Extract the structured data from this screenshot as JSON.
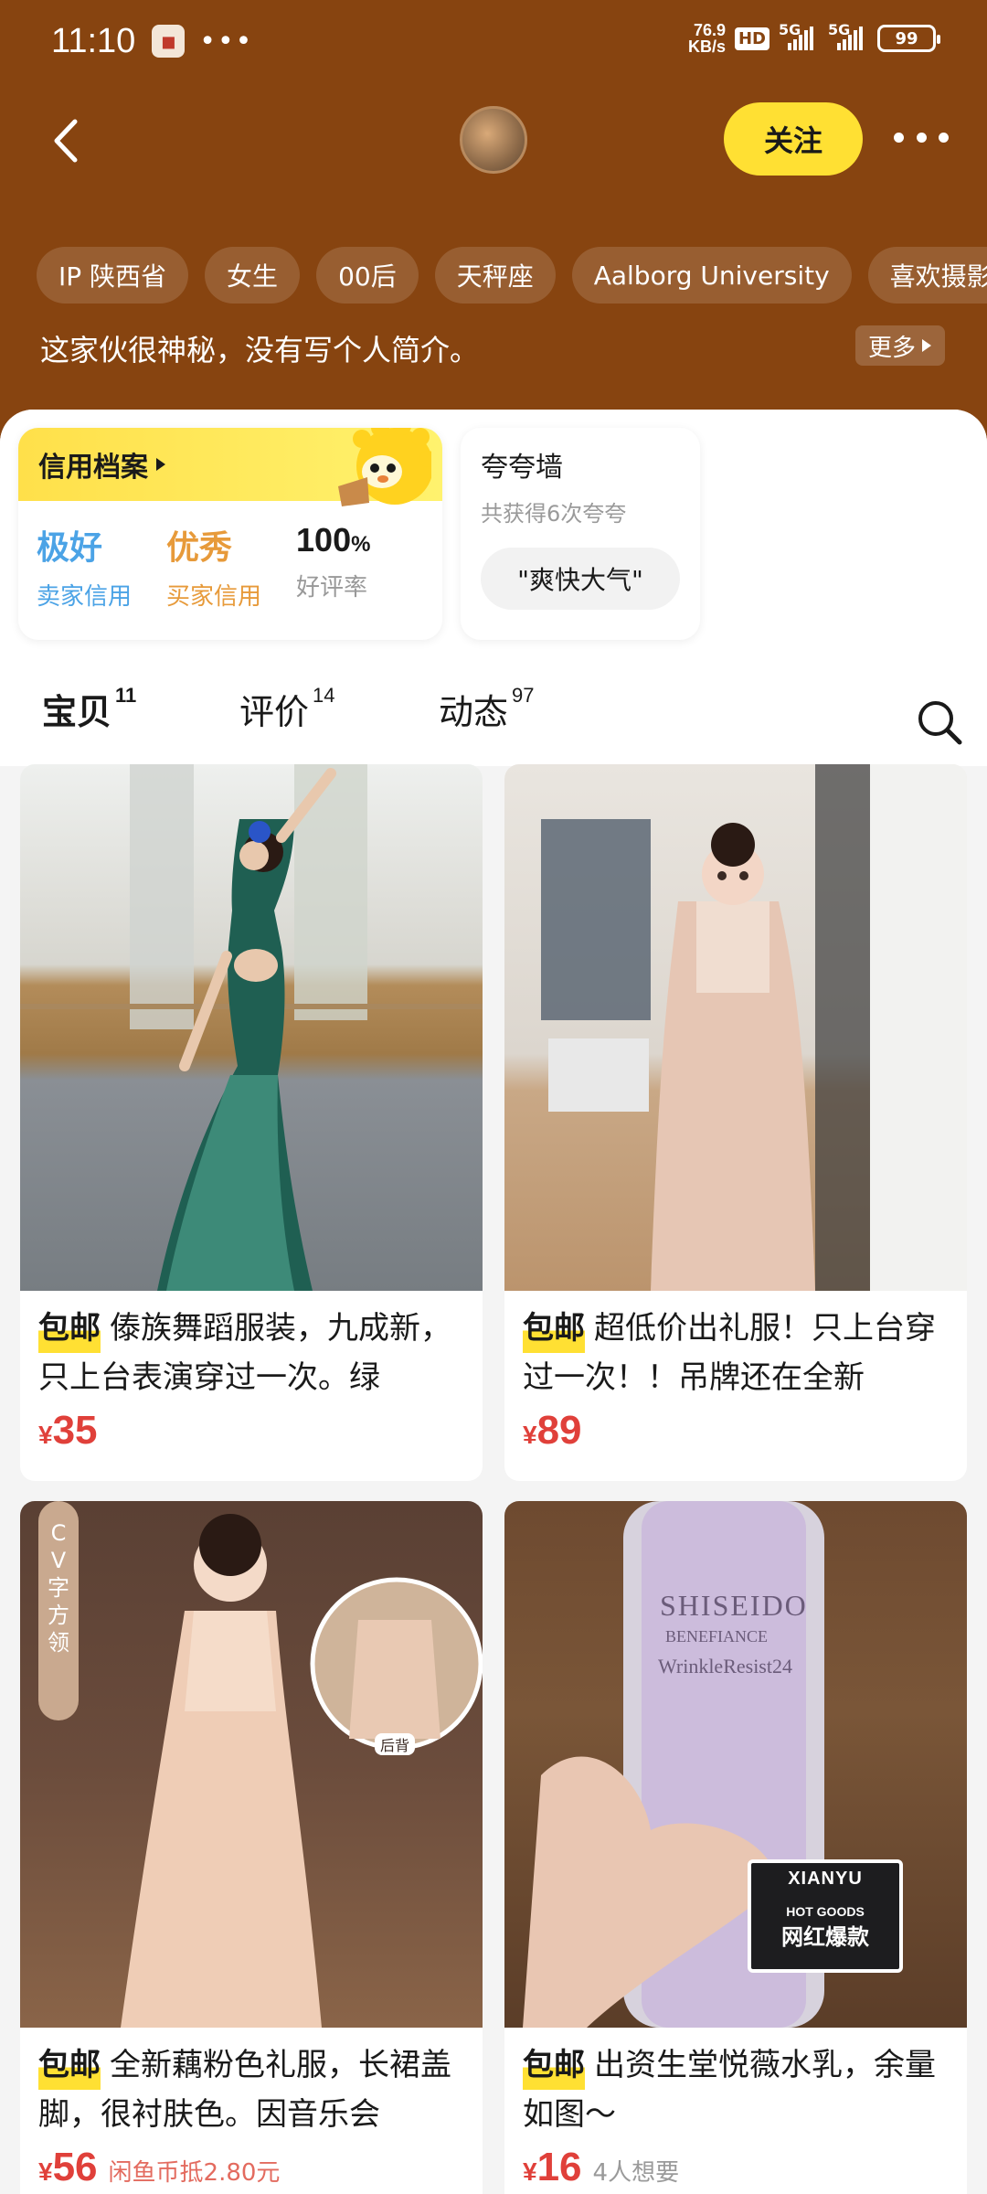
{
  "status_bar": {
    "time": "11:10",
    "net_speed_value": "76.9",
    "net_speed_unit": "KB/s",
    "hd_label": "HD",
    "signal1_label": "5G",
    "signal2_label": "5G",
    "battery": "99"
  },
  "profile": {
    "follow_label": "关注",
    "tags": [
      "IP 陕西省",
      "女生",
      "00后",
      "天秤座",
      "Aalborg University",
      "喜欢摄影、"
    ],
    "bio": "这家伙很神秘，没有写个人简介。",
    "more_label": "更多"
  },
  "credit": {
    "title": "信用档案",
    "seller_value": "极好",
    "seller_label": "卖家信用",
    "buyer_value": "优秀",
    "buyer_label": "买家信用",
    "rate_value": "100",
    "rate_unit": "%",
    "rate_label": "好评率"
  },
  "praise": {
    "title": "夸夸墙",
    "subtitle": "共获得6次夸夸",
    "chip": "\"爽快大气\""
  },
  "tabs": [
    {
      "label": "宝贝",
      "count": "11"
    },
    {
      "label": "评价",
      "count": "14"
    },
    {
      "label": "动态",
      "count": "97"
    }
  ],
  "products": [
    {
      "tag": "包邮",
      "title": "傣族舞蹈服装，九成新，只上台表演穿过一次。绿",
      "yen": "¥",
      "price": "35",
      "extra": ""
    },
    {
      "tag": "包邮",
      "title": "超低价出礼服！只上台穿过一次！！吊牌还在全新",
      "yen": "¥",
      "price": "89",
      "extra": ""
    },
    {
      "tag": "包邮",
      "title": "全新藕粉色礼服，长裙盖脚，很衬肤色。因音乐会",
      "yen": "¥",
      "price": "56",
      "extra": "闲鱼币抵2.80元"
    },
    {
      "tag": "包邮",
      "title": "出资生堂悦薇水乳，余量如图～",
      "yen": "¥",
      "price": "16",
      "extra": "4人想要"
    }
  ],
  "image_texts": {
    "p3_side": "C V字方领",
    "p3_inset": "后背",
    "p4_brand": "SHISEIDO",
    "p4_line": "BENEFIANCE",
    "p4_product": "WrinkleResist24",
    "p4_badge_top": "XIANYU",
    "p4_badge_mid": "HOT GOODS",
    "p4_badge_bottom": "网红爆款"
  },
  "colors": {
    "header_bg": "#874410",
    "accent_yellow": "#ffe033",
    "price_red": "#e0403a",
    "seller_blue": "#4ba3e6",
    "buyer_orange": "#e79a3a"
  },
  "icons": [
    "back-arrow-icon",
    "more-dots-icon",
    "triangle-right-icon",
    "search-icon"
  ]
}
